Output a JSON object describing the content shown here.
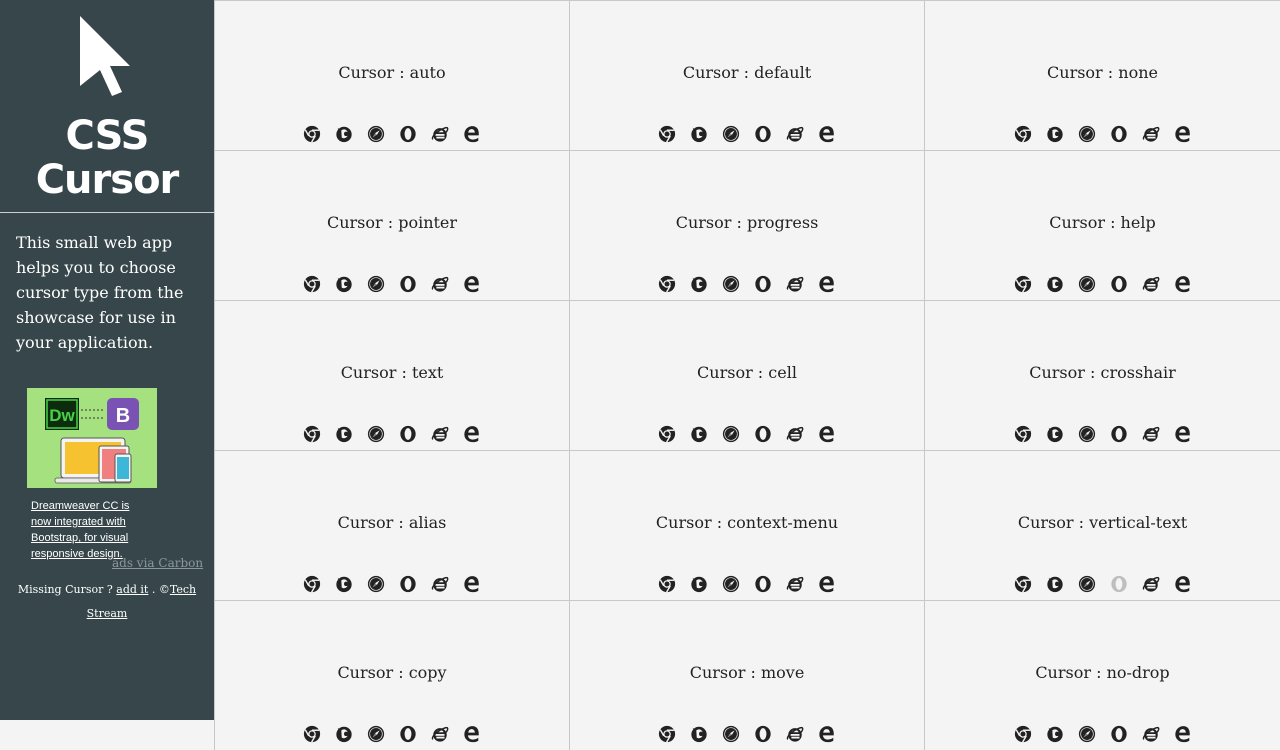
{
  "sidebar": {
    "brand_line1": "CSS",
    "brand_line2": "Cursor",
    "description": "This small web app helps you to choose cursor type from the showcase for use in your application.",
    "ad": {
      "image_badge_left": "Dw",
      "image_badge_right": "B",
      "text": "Dreamweaver CC is now integrated with Bootstrap, for visual responsive design.",
      "via": "ads via Carbon"
    },
    "footer": {
      "prefix": "Missing Cursor ?",
      "add_link": "add it",
      "separator": ".",
      "copyright": "©",
      "credit_link": "Tech Stream"
    }
  },
  "browser_icons": [
    "chrome-icon",
    "firefox-icon",
    "safari-icon",
    "opera-icon",
    "ie-icon",
    "edge-icon"
  ],
  "cursors": [
    {
      "label": "Cursor : auto"
    },
    {
      "label": "Cursor : default"
    },
    {
      "label": "Cursor : none"
    },
    {
      "label": "Cursor : pointer"
    },
    {
      "label": "Cursor : progress"
    },
    {
      "label": "Cursor : help"
    },
    {
      "label": "Cursor : text"
    },
    {
      "label": "Cursor : cell"
    },
    {
      "label": "Cursor : crosshair"
    },
    {
      "label": "Cursor : alias"
    },
    {
      "label": "Cursor : context-menu"
    },
    {
      "label": "Cursor : vertical-text",
      "unsupported": [
        "opera-icon"
      ]
    },
    {
      "label": "Cursor : copy"
    },
    {
      "label": "Cursor : move"
    },
    {
      "label": "Cursor : no-drop"
    }
  ],
  "colors": {
    "sidebar_bg": "#37464b",
    "page_bg": "#f4f4f4",
    "ad_bg": "#a5e27f"
  }
}
